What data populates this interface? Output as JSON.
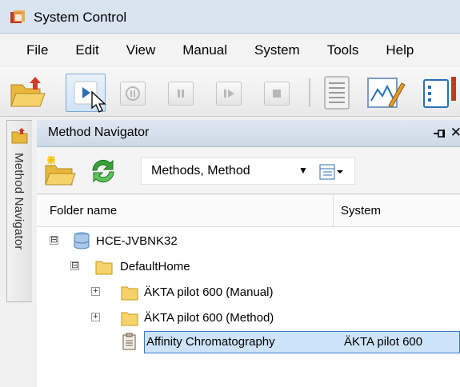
{
  "window": {
    "title": "System Control"
  },
  "menu": {
    "items": [
      "File",
      "Edit",
      "View",
      "Manual",
      "System",
      "Tools",
      "Help"
    ]
  },
  "toolbar": {
    "buttons": [
      "open-folder",
      "run",
      "pause-hold",
      "pause",
      "step",
      "stop",
      "run-log",
      "evaluation",
      "method-editor"
    ]
  },
  "side_tab": {
    "label": "Method Navigator"
  },
  "navigator": {
    "title": "Method Navigator",
    "close_symbol": "✕",
    "view_select": {
      "value": "Methods, Method"
    },
    "columns": {
      "folder_name": "Folder name",
      "system": "System"
    },
    "tree": {
      "root": {
        "label": "HCE-JVBNK32",
        "expander": "⊟"
      },
      "home": {
        "label": "DefaultHome",
        "expander": "⊟"
      },
      "folder_manual": {
        "label": "ÄKTA pilot 600 (Manual)",
        "expander": "+"
      },
      "folder_method": {
        "label": "ÄKTA pilot 600 (Method)",
        "expander": "+"
      },
      "method": {
        "label": "Affinity Chromatography",
        "system": "ÄKTA pilot 600",
        "selected": true
      }
    }
  },
  "colors": {
    "selection_bg": "#cde3f8",
    "selection_border": "#3b78c7",
    "folder": "#f4c542",
    "title_bar": "#d8e4f0"
  }
}
